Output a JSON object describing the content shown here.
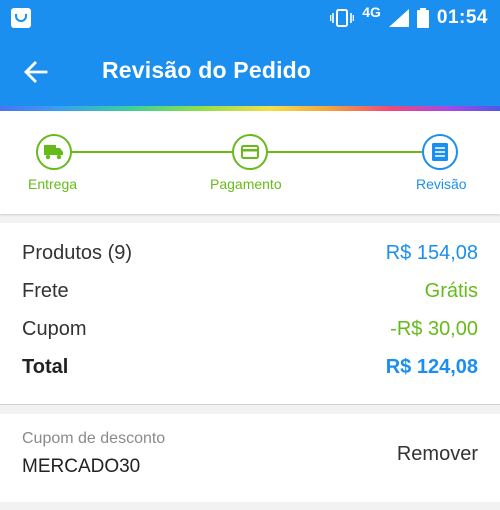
{
  "status_bar": {
    "notification_icon": "shopping-bag-icon",
    "network": "4G",
    "time": "01:54",
    "icons": [
      "vibrate-icon",
      "signal-icon",
      "battery-icon"
    ]
  },
  "app_bar": {
    "back_icon": "arrow-left-icon",
    "title": "Revisão do Pedido"
  },
  "stepper": {
    "steps": [
      {
        "label": "Entrega",
        "icon": "truck-icon",
        "state": "done"
      },
      {
        "label": "Pagamento",
        "icon": "card-icon",
        "state": "done"
      },
      {
        "label": "Revisão",
        "icon": "list-icon",
        "state": "current"
      }
    ]
  },
  "summary": {
    "rows": [
      {
        "label": "Produtos (9)",
        "value": "R$ 154,08"
      },
      {
        "label": "Frete",
        "value": "Grátis"
      },
      {
        "label": "Cupom",
        "value": "-R$ 30,00"
      },
      {
        "label": "Total",
        "value": "R$ 124,08"
      }
    ]
  },
  "coupon": {
    "label": "Cupom de desconto",
    "code": "MERCADO30",
    "remove_label": "Remover"
  },
  "colors": {
    "primary": "#1a8ff0",
    "success": "#66bb1a",
    "price_blue": "#1a8ff0"
  }
}
